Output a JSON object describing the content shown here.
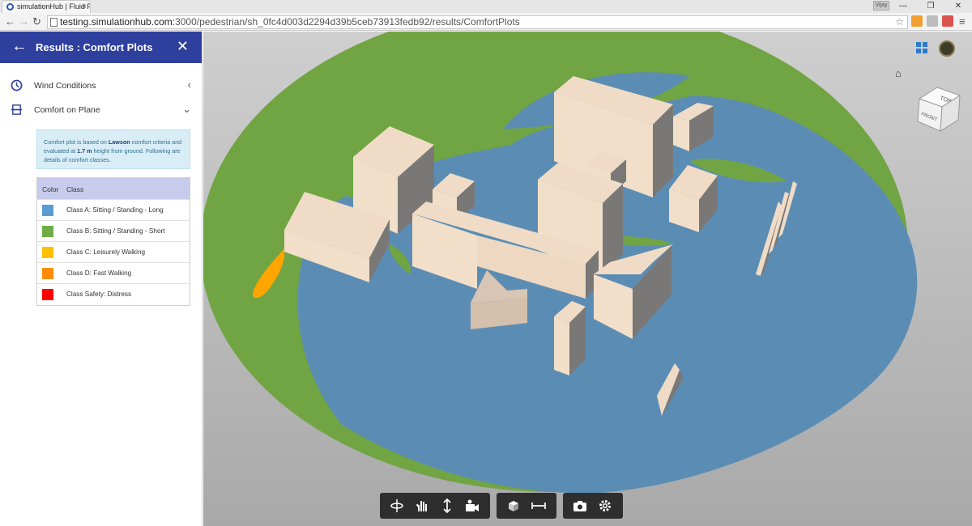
{
  "browser": {
    "tab_title": "simulationHub | Fluid Flo",
    "tab_close": "×",
    "user_badge": "Vijay",
    "url_host": "testing.simulationhub.com",
    "url_path": ":3000/pedestrian/sh_0fc4d003d2294d39b5ceb73913fedb92/results/ComfortPlots",
    "window_controls": [
      "—",
      "❐",
      "✕"
    ]
  },
  "sidebar": {
    "header_title": "Results : Comfort Plots",
    "back_glyph": "←",
    "close_glyph": "✕",
    "sections": [
      {
        "label": "Wind Conditions",
        "chevron": "‹"
      },
      {
        "label": "Comfort on Plane",
        "chevron": "⌄"
      }
    ],
    "info": {
      "prefix": "Comfort plot is based on ",
      "criteria": "Lawson",
      "mid": " comfort criteria and evaluated at ",
      "height": "1.7 m",
      "suffix": " height from ground. Following are details of comfort classes."
    },
    "table": {
      "headers": [
        "Color",
        "Class"
      ],
      "rows": [
        {
          "label": "Class A: Sitting / Standing - Long",
          "color": "#5b9bd5"
        },
        {
          "label": "Class B: Sitting / Standing - Short",
          "color": "#70ad47"
        },
        {
          "label": "Class C: Leisurely Walking",
          "color": "#ffc000"
        },
        {
          "label": "Class D: Fast Walking",
          "color": "#ff8c00"
        },
        {
          "label": "Class Safety: Distress",
          "color": "#ff0000"
        }
      ]
    }
  },
  "colors": {
    "header": "#2e3f9e",
    "ground_green": "#71a443",
    "ground_blue": "#5b8db4",
    "building_light": "#f0dcc6",
    "building_mid": "#d9c5b3",
    "building_dark": "#7a7877",
    "contour_orange": "#ffa500"
  },
  "viewcube": {
    "top": "TOP",
    "front": "FRONT"
  },
  "toolbar": {
    "groups": [
      [
        "orbit-icon",
        "pan-icon",
        "zoom-icon",
        "camera-fly-icon"
      ],
      [
        "model-browser-icon",
        "measure-icon"
      ],
      [
        "screenshot-icon",
        "settings-icon"
      ]
    ]
  }
}
